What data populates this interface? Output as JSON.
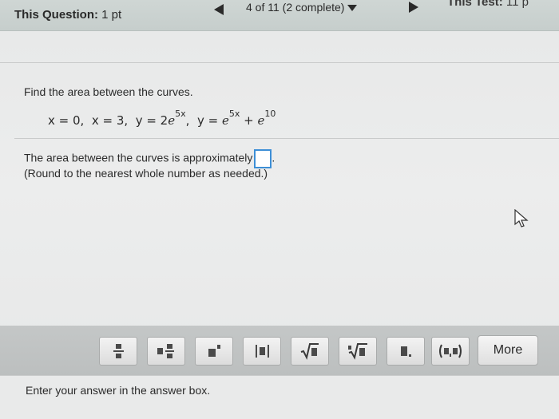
{
  "header": {
    "question_label": "This Question:",
    "question_points": "1 pt",
    "progress": "4 of 11 (2 complete)",
    "test_label": "This Test:",
    "test_points": "11 p"
  },
  "question": {
    "prompt": "Find the area between the curves.",
    "eq_x0": "x = 0,",
    "eq_x3": "x = 3,",
    "eq_y1_prefix": "y = 2",
    "eq_y1_base": "e",
    "eq_y1_exp": "5x",
    "eq_sep": ",",
    "eq_y2_prefix": "y =",
    "eq_y2_base": "e",
    "eq_y2_exp": "5x",
    "eq_plus": "+",
    "eq_y2_base2": "e",
    "eq_y2_exp2": "10",
    "answer_text": "The area between the curves is approximately",
    "answer_value": "",
    "round_note": "(Round to the nearest whole number as needed.)"
  },
  "toolbar": {
    "tools": [
      {
        "name": "fraction",
        "glyph": "▪/▪"
      },
      {
        "name": "mixed-number",
        "glyph": "▪▪/▪"
      },
      {
        "name": "exponent",
        "glyph": "▪ˣ"
      },
      {
        "name": "absolute-value",
        "glyph": "|▪|"
      },
      {
        "name": "square-root",
        "glyph": "√▪"
      },
      {
        "name": "nth-root",
        "glyph": "ⁿ√▪"
      },
      {
        "name": "decimal",
        "glyph": "▪."
      },
      {
        "name": "interval",
        "glyph": "(▪,▪)"
      }
    ],
    "more_label": "More"
  },
  "status": {
    "text": "Enter your answer in the answer box."
  },
  "colors": {
    "answer_box_border": "#3d8fd6",
    "toolbar_bg": "#c4c7c7"
  }
}
